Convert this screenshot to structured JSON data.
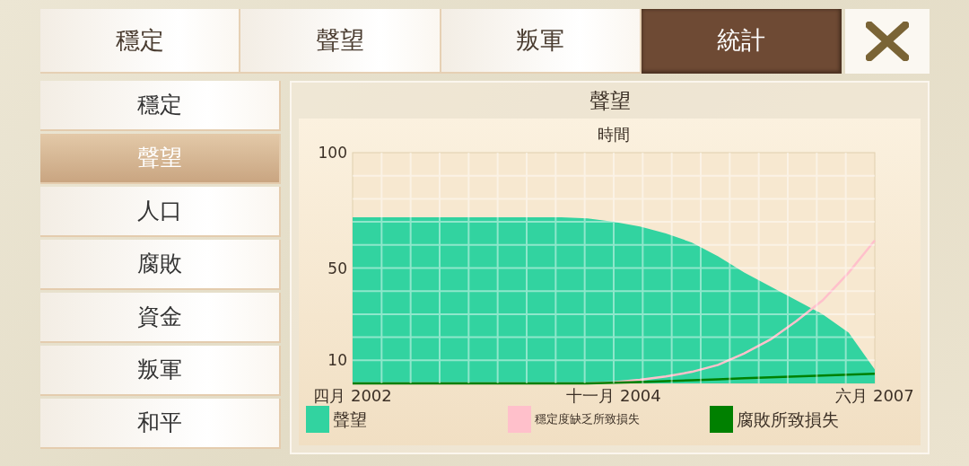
{
  "tabs": [
    {
      "label": "穩定",
      "selected": false
    },
    {
      "label": "聲望",
      "selected": false
    },
    {
      "label": "叛軍",
      "selected": false
    },
    {
      "label": "統計",
      "selected": true
    }
  ],
  "sidebar": {
    "items": [
      {
        "label": "穩定",
        "selected": false
      },
      {
        "label": "聲望",
        "selected": true
      },
      {
        "label": "人口",
        "selected": false
      },
      {
        "label": "腐敗",
        "selected": false
      },
      {
        "label": "資金",
        "selected": false
      },
      {
        "label": "叛軍",
        "selected": false
      },
      {
        "label": "和平",
        "selected": false
      }
    ]
  },
  "panel": {
    "title": "聲望",
    "chart_data": {
      "type": "area",
      "title": "時間",
      "categories": [
        "四月 2002",
        null,
        null,
        null,
        null,
        null,
        null,
        null,
        null,
        null,
        "十一月 2004",
        null,
        null,
        null,
        null,
        null,
        null,
        null,
        null,
        null,
        "六月 2007"
      ],
      "ylim": [
        0,
        100
      ],
      "yticks": [
        10,
        50,
        100
      ],
      "grid": true,
      "series": [
        {
          "name": "聲望",
          "type": "area",
          "color": "#32d3a0",
          "values": [
            72,
            72,
            72,
            72,
            72,
            72,
            72,
            72,
            72,
            71.5,
            70,
            68,
            65,
            61,
            55,
            48,
            42,
            36,
            30,
            22,
            6
          ]
        },
        {
          "name": "穩定度缺乏所致損失",
          "type": "line",
          "color": "#ffc0cb",
          "values": [
            0,
            0,
            0,
            0,
            0,
            0,
            0,
            0,
            0,
            0,
            0.5,
            1.5,
            3,
            5,
            8,
            13,
            19,
            27,
            36,
            48,
            62
          ]
        },
        {
          "name": "腐敗所致損失",
          "type": "line",
          "color": "#008000",
          "values": [
            0,
            0,
            0,
            0,
            0,
            0,
            0,
            0,
            0,
            0,
            0.3,
            0.6,
            1,
            1.4,
            1.8,
            2.2,
            2.6,
            3,
            3.4,
            3.8,
            4.2
          ]
        }
      ]
    }
  }
}
